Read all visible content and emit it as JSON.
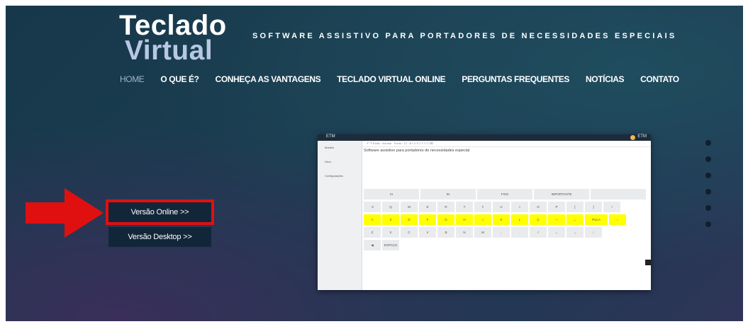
{
  "brand": {
    "line1": "Teclado",
    "line2": "Virtual",
    "tagline": "SOFTWARE ASSISTIVO PARA PORTADORES DE NECESSIDADES ESPECIAIS"
  },
  "nav": [
    "HOME",
    "O QUE É?",
    "CONHEÇA AS VANTAGENS",
    "TECLADO VIRTUAL ONLINE",
    "PERGUNTAS FREQUENTES",
    "NOTÍCIAS",
    "CONTATO"
  ],
  "buttons": {
    "online": "Versão Online >>",
    "desktop": "Versão Desktop >>"
  },
  "preview": {
    "app_title": "ETM",
    "user": "ETM",
    "sidebar": [
      "Modelo",
      "Visor",
      "Configurações"
    ],
    "toolbar": "↶  ↷   Estilo  ·  Normal  ·  Fonte  ·  12  ·   B  I  U  S  ≡  ≡  ≡  ≡   ⌫",
    "document_text": "Software assistivo para portadores de necessidades especial",
    "keyboard": {
      "row1": [
        "III",
        "IN",
        "FIXO",
        "IMPORTANTE"
      ],
      "row2": [
        "⇥",
        "Q",
        "W",
        "E",
        "R",
        "T",
        "Y",
        "U",
        "I",
        "O",
        "P",
        "[",
        "]",
        "\\"
      ],
      "row3": [
        "A",
        "S",
        "D",
        "F",
        "G",
        "H",
        "I",
        "K",
        "L",
        "Ç",
        "~",
        "←",
        "PULA",
        "↓"
      ],
      "row4": [
        "Z",
        "X",
        "C",
        "V",
        "B",
        "N",
        "M",
        ",",
        ".",
        "/",
        "←",
        "→",
        "↑"
      ],
      "row5": [
        "◀",
        "ESPAÇO"
      ]
    }
  },
  "colors": {
    "highlight_red": "#e01010",
    "key_yellow": "#ffff00",
    "button_bg": "#12263a"
  }
}
